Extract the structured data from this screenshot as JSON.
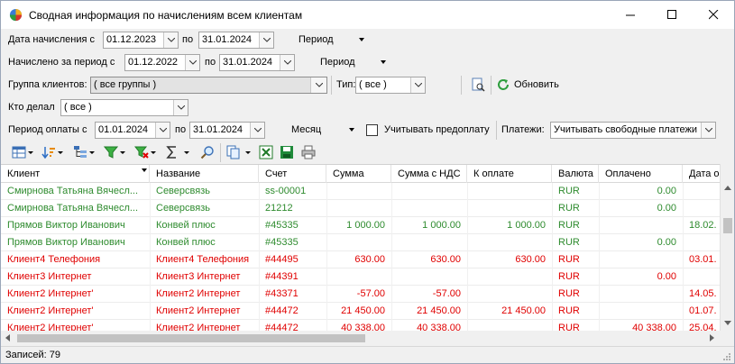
{
  "window": {
    "title": "Сводная информация по начислениям всем клиентам"
  },
  "filters": {
    "accrual_date": {
      "label": "Дата начисления с",
      "from": "01.12.2023",
      "to_label": "по",
      "to": "31.01.2024",
      "period_label": "Период"
    },
    "accrued_period": {
      "label": "Начислено за период с",
      "from": "01.12.2022",
      "to_label": "по",
      "to": "31.01.2024",
      "period_label": "Период"
    },
    "client_group": {
      "label": "Группа клиентов:",
      "value": "( все группы )",
      "type_label": "Тип:",
      "type_value": "( все )",
      "refresh_label": "Обновить"
    },
    "who": {
      "label": "Кто делал",
      "value": "( все )"
    },
    "payment_period": {
      "label": "Период оплаты с",
      "from": "01.01.2024",
      "to_label": "по",
      "to": "31.01.2024",
      "period_label": "Месяц",
      "prepay_label": "Учитывать предоплату",
      "payments_label": "Платежи:",
      "payments_value": "Учитывать свободные платежи ка"
    }
  },
  "toolbar": {
    "icons": [
      "grid-layout-icon",
      "sort-icon",
      "tree-icon",
      "filter-icon",
      "filter-clear-icon",
      "sum-icon",
      "search-icon",
      "copy-icon",
      "export-excel-icon",
      "save-icon",
      "print-icon"
    ]
  },
  "grid": {
    "columns": [
      "Клиент",
      "Название",
      "Счет",
      "Сумма",
      "Сумма с НДС",
      "К оплате",
      "Валюта",
      "Оплачено",
      "Дата опе"
    ],
    "rows": [
      {
        "color": "green",
        "cells": [
          "Смирнова Татьяна Вячесл...",
          "Северсвязь",
          "ss-00001",
          "",
          "",
          "",
          "RUR",
          "0.00",
          ""
        ]
      },
      {
        "color": "green",
        "cells": [
          "Смирнова Татьяна Вячесл...",
          "Северсвязь",
          "21212",
          "",
          "",
          "",
          "RUR",
          "0.00",
          ""
        ]
      },
      {
        "color": "green",
        "cells": [
          "Прямов Виктор Иванович",
          "Конвей плюс",
          "#45335",
          "1 000.00",
          "1 000.00",
          "1 000.00",
          "RUR",
          "",
          "18.02."
        ]
      },
      {
        "color": "green",
        "cells": [
          "Прямов Виктор Иванович",
          "Конвей плюс",
          "#45335",
          "",
          "",
          "",
          "RUR",
          "0.00",
          ""
        ]
      },
      {
        "color": "red",
        "cells": [
          "Клиент4 Телефония",
          "Клиент4 Телефония",
          "#44495",
          "630.00",
          "630.00",
          "630.00",
          "RUR",
          "",
          "03.01."
        ]
      },
      {
        "color": "red",
        "cells": [
          "Клиент3 Интернет",
          "Клиент3 Интернет",
          "#44391",
          "",
          "",
          "",
          "RUR",
          "0.00",
          ""
        ]
      },
      {
        "color": "red",
        "cells": [
          "Клиент2 Интернет'",
          "Клиент2 Интернет",
          "#43371",
          "-57.00",
          "-57.00",
          "",
          "RUR",
          "",
          "14.05."
        ]
      },
      {
        "color": "red",
        "cells": [
          "Клиент2 Интернет'",
          "Клиент2 Интернет",
          "#44472",
          "21 450.00",
          "21 450.00",
          "21 450.00",
          "RUR",
          "",
          "01.07."
        ]
      },
      {
        "color": "red",
        "cells": [
          "Клиент2 Интернет'",
          "Клиент2 Интернет",
          "#44472",
          "40 338.00",
          "40 338.00",
          "",
          "RUR",
          "40 338.00",
          "25.04."
        ]
      }
    ]
  },
  "status": {
    "records_label": "Записей: 79"
  },
  "colors": {
    "green": "#2e8b2e",
    "red": "#e00000"
  }
}
